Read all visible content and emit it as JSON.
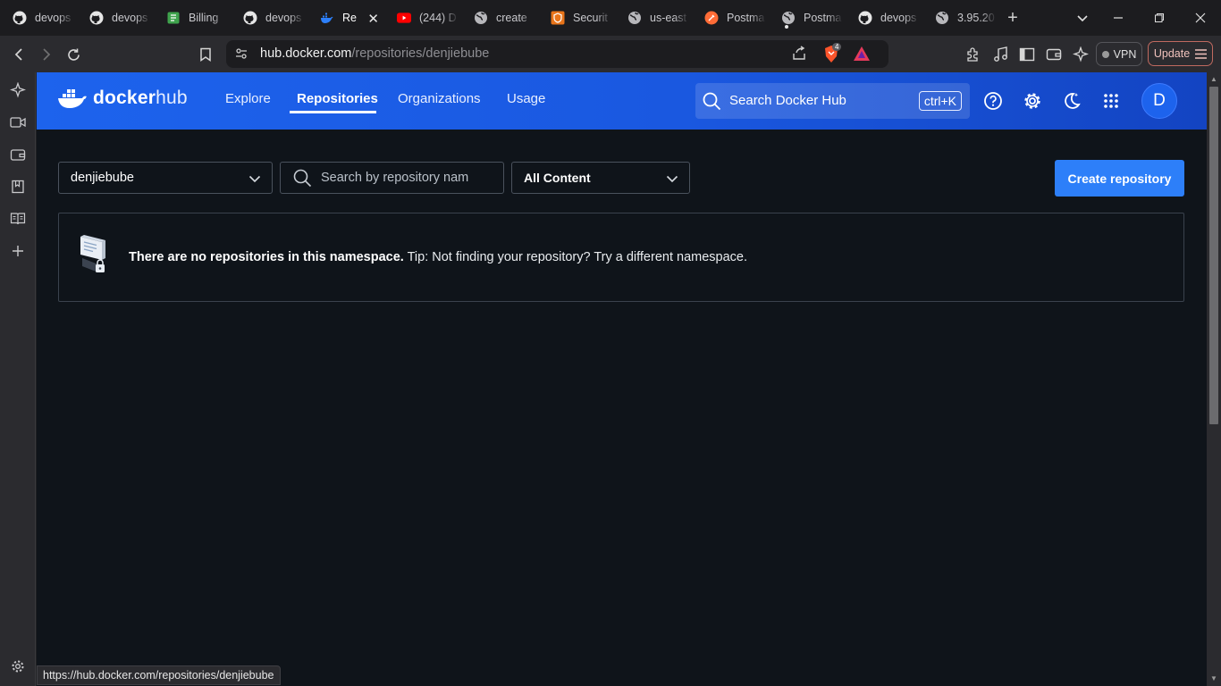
{
  "browser": {
    "tabs": [
      {
        "label": "devops",
        "icon": "github-icon",
        "active": false
      },
      {
        "label": "devops",
        "icon": "github-icon",
        "active": false
      },
      {
        "label": "Billing",
        "icon": "billing-icon",
        "active": false
      },
      {
        "label": "devops",
        "icon": "github-icon",
        "active": false
      },
      {
        "label": "Re",
        "icon": "docker-icon",
        "active": true
      },
      {
        "label": "(244) D",
        "icon": "youtube-icon",
        "active": false
      },
      {
        "label": "create",
        "icon": "globe-icon",
        "active": false
      },
      {
        "label": "Securit",
        "icon": "aws-icon",
        "active": false
      },
      {
        "label": "us-east",
        "icon": "globe-icon",
        "active": false
      },
      {
        "label": "Postma",
        "icon": "postman-icon",
        "active": false
      },
      {
        "label": "Postma",
        "icon": "globe-icon",
        "active": false
      },
      {
        "label": "devops",
        "icon": "github-icon",
        "active": false
      },
      {
        "label": "3.95.20",
        "icon": "globe-icon",
        "active": false
      }
    ],
    "url_host": "hub.docker.com",
    "url_path": "/repositories/denjiebube",
    "vpn_label": "VPN",
    "update_label": "Update",
    "brave_shield_count": "4",
    "status_url": "https://hub.docker.com/repositories/denjiebube"
  },
  "hub": {
    "logo_docker": "docker",
    "logo_hub": "hub",
    "nav": {
      "explore": "Explore",
      "repositories": "Repositories",
      "organizations": "Organizations",
      "usage": "Usage"
    },
    "search_placeholder": "Search Docker Hub",
    "search_shortcut": "ctrl+K",
    "avatar_initial": "D"
  },
  "main": {
    "namespace": "denjiebube",
    "repo_search_placeholder": "Search by repository name",
    "content_filter": "All Content",
    "create_button": "Create repository",
    "empty_bold": "There are no repositories in this namespace.",
    "empty_tip": " Tip: Not finding your repository? Try a different namespace."
  },
  "colors": {
    "header_blue": "#1d63ed",
    "button_blue": "#2d7ff9",
    "page_bg": "#0f141a"
  }
}
